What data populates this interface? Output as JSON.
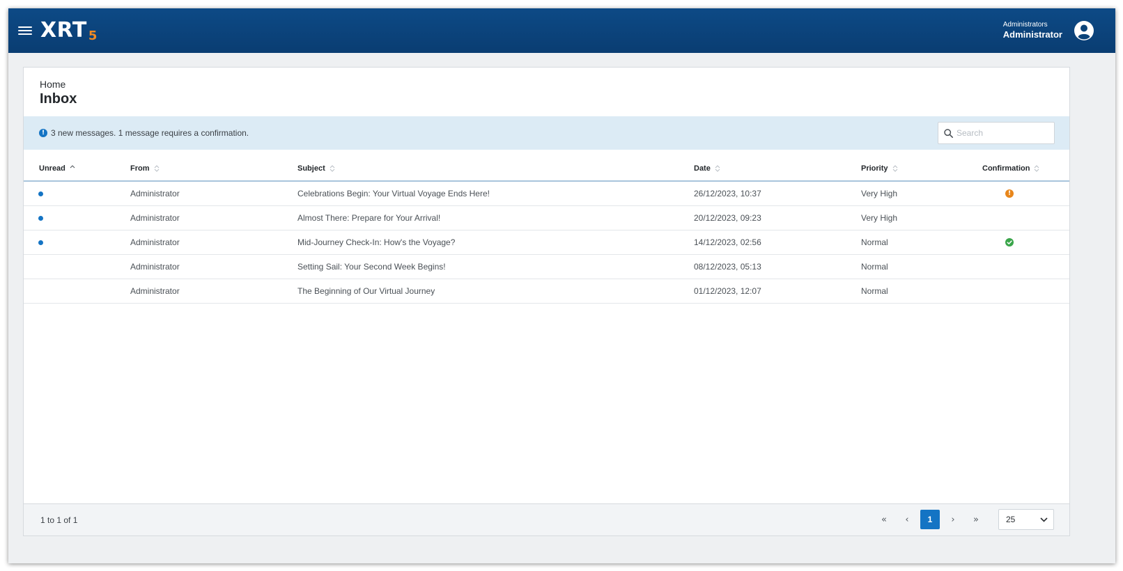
{
  "header": {
    "logo_text": "XRT",
    "logo_version": "5",
    "user_group": "Administrators",
    "user_name": "Administrator",
    "menu_icon": "hamburger-menu-icon",
    "avatar_icon": "user-avatar-icon",
    "brand_color": "#0b4379",
    "accent_color": "#f08a24"
  },
  "page": {
    "breadcrumb": "Home",
    "title": "Inbox"
  },
  "notice": {
    "icon": "info-icon",
    "text": "3 new messages. 1 message requires a confirmation."
  },
  "search": {
    "placeholder": "Search",
    "value": ""
  },
  "table": {
    "columns": {
      "unread": "Unread",
      "from": "From",
      "subject": "Subject",
      "date": "Date",
      "priority": "Priority",
      "confirmation": "Confirmation"
    },
    "rows": [
      {
        "unread": true,
        "from": "Administrator",
        "subject": "Celebrations Begin: Your Virtual Voyage Ends Here!",
        "date": "26/12/2023, 10:37",
        "priority": "Very High",
        "confirmation": "pending"
      },
      {
        "unread": true,
        "from": "Administrator",
        "subject": "Almost There: Prepare for Your Arrival!",
        "date": "20/12/2023, 09:23",
        "priority": "Very High",
        "confirmation": "none"
      },
      {
        "unread": true,
        "from": "Administrator",
        "subject": "Mid-Journey Check-In: How's the Voyage?",
        "date": "14/12/2023, 02:56",
        "priority": "Normal",
        "confirmation": "confirmed"
      },
      {
        "unread": false,
        "from": "Administrator",
        "subject": "Setting Sail: Your Second Week Begins!",
        "date": "08/12/2023, 05:13",
        "priority": "Normal",
        "confirmation": "none"
      },
      {
        "unread": false,
        "from": "Administrator",
        "subject": "The Beginning of Our Virtual Journey",
        "date": "01/12/2023, 12:07",
        "priority": "Normal",
        "confirmation": "none"
      }
    ],
    "status_colors": {
      "unread": "#1474c4",
      "pending": "#e8861b",
      "confirmed": "#3aa54a"
    }
  },
  "footer": {
    "page_info": "1 to 1 of 1",
    "current_page": "1",
    "page_size": "25"
  }
}
